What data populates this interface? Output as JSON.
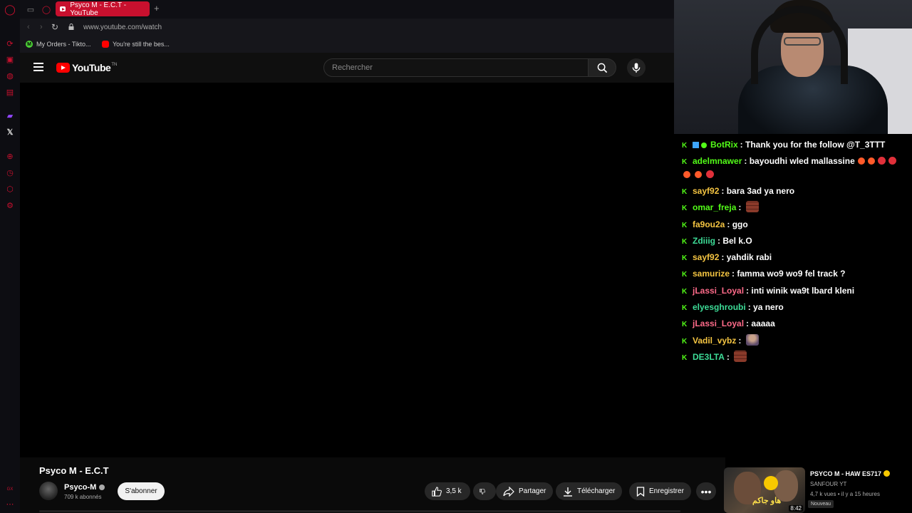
{
  "browser": {
    "tab_title": "Psyco M - E.C.T - YouTube",
    "url": "www.youtube.com/watch",
    "bookmarks": [
      {
        "label": "My Orders - Tikto...",
        "icon": "tiktok-shop-icon",
        "color": "#4cd137"
      },
      {
        "label": "You're still the bes...",
        "icon": "youtube-icon",
        "color": "#ff0000"
      }
    ]
  },
  "youtube": {
    "logo_text": "YouTube",
    "logo_suffix": "TN",
    "search_placeholder": "Rechercher"
  },
  "video": {
    "title": "Psyco M - E.C.T",
    "channel": "Psyco-M",
    "subscribers": "709 k abonnés",
    "subscribe_label": "S'abonner",
    "likes": "3,5 k",
    "share_label": "Partager",
    "download_label": "Télécharger",
    "save_label": "Enregistrer"
  },
  "recommended": {
    "title": "PSYCO M - HAW ES717",
    "channel": "SANFOUR YT",
    "meta": "4,7 k vues • il y a 15 heures",
    "badge": "Nouveau",
    "duration": "8:42",
    "thumb_text": "هاو جاكم"
  },
  "chat": [
    {
      "user": "BotRix",
      "color": "#53fc18",
      "text": "Thank you for the follow @T_3TTT",
      "badges": [
        "bot"
      ]
    },
    {
      "user": "adelmnawer",
      "color": "#53fc18",
      "text": "bayoudhi wled mallassine",
      "emotes": [
        "boom",
        "boom",
        "mad",
        "mad"
      ],
      "emotes_line2": [
        "boom",
        "boom",
        "mad"
      ]
    },
    {
      "user": "sayf92",
      "color": "#f5c542",
      "text": "bara 3ad ya nero"
    },
    {
      "user": "omar_freja",
      "color": "#53fc18",
      "text": "",
      "emotes": [
        "bricks"
      ]
    },
    {
      "user": "fa9ou2a",
      "color": "#f5c542",
      "text": "ggo"
    },
    {
      "user": "Zdiiig",
      "color": "#3ddc97",
      "text": "Bel k.O"
    },
    {
      "user": "sayf92",
      "color": "#f5c542",
      "text": "yahdik rabi"
    },
    {
      "user": "samurize",
      "color": "#f5c542",
      "text": "famma wo9 wo9 fel track ?"
    },
    {
      "user": "jLassi_Loyal",
      "color": "#ff6b8a",
      "text": "inti winik wa9t lbard kleni"
    },
    {
      "user": "elyesghroubi",
      "color": "#3ddc97",
      "text": "ya nero"
    },
    {
      "user": "jLassi_Loyal",
      "color": "#ff6b8a",
      "text": "aaaaa"
    },
    {
      "user": "Vadil_vybz",
      "color": "#f5c542",
      "text": "",
      "emotes": [
        "girl"
      ]
    },
    {
      "user": "DE3LTA",
      "color": "#3ddc97",
      "text": "",
      "emotes": [
        "bricks"
      ]
    }
  ],
  "sidebar_icons": [
    "opera-icon",
    "refresh-icon",
    "shop-icon",
    "messenger-icon",
    "music-icon",
    "twitch-icon",
    "x-icon",
    "add-icon",
    "history-icon",
    "extensions-icon",
    "settings-icon"
  ],
  "colors": {
    "accent": "#c8102e",
    "kick_green": "#53fc18",
    "youtube_red": "#ff0000"
  }
}
